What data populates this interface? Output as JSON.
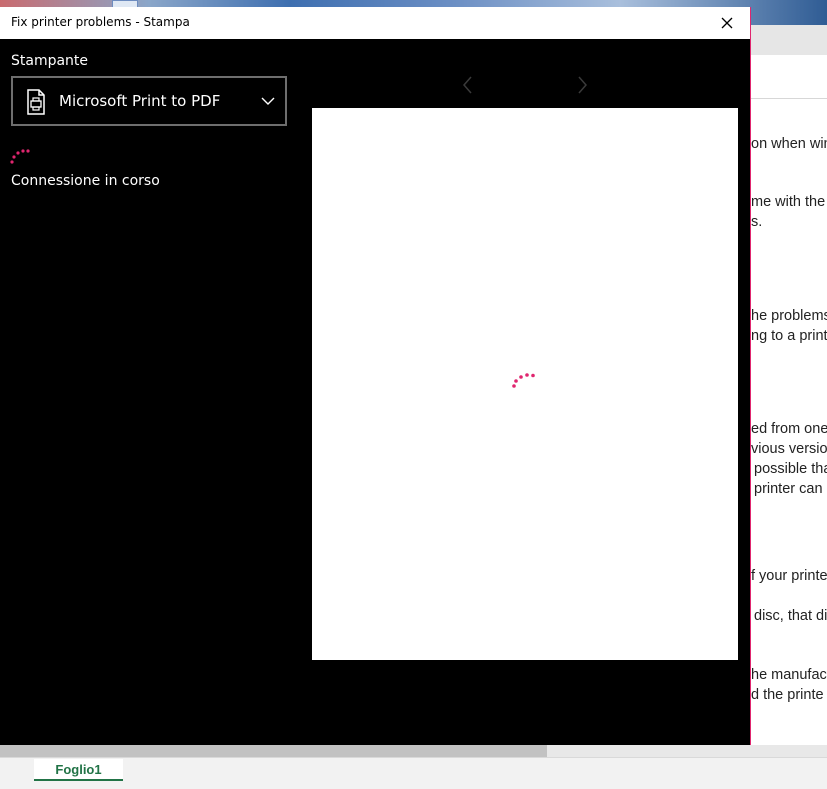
{
  "dialog": {
    "title": "Fix printer problems - Stampa",
    "printer_label": "Stampante",
    "printer_selected": "Microsoft Print to PDF",
    "status": "Connessione in corso"
  },
  "background_document": {
    "lines": [
      "on when win",
      "me with the",
      "s.",
      "he problems",
      "ng to a print",
      "ed from one",
      "vious version",
      "possible tha",
      "printer can",
      "f your printe",
      "disc, that di",
      "he manufact",
      "d the printe"
    ]
  },
  "sheet_tab": {
    "label": "Foglio1"
  },
  "colors": {
    "accent_spinner": "#e0266f",
    "dialog_bg": "#000000",
    "sheet_tab_accent": "#217346"
  },
  "icons": [
    "close-icon",
    "printer-icon",
    "chevron-down-icon",
    "chevron-left-icon",
    "chevron-right-icon",
    "loading-spinner-icon"
  ]
}
